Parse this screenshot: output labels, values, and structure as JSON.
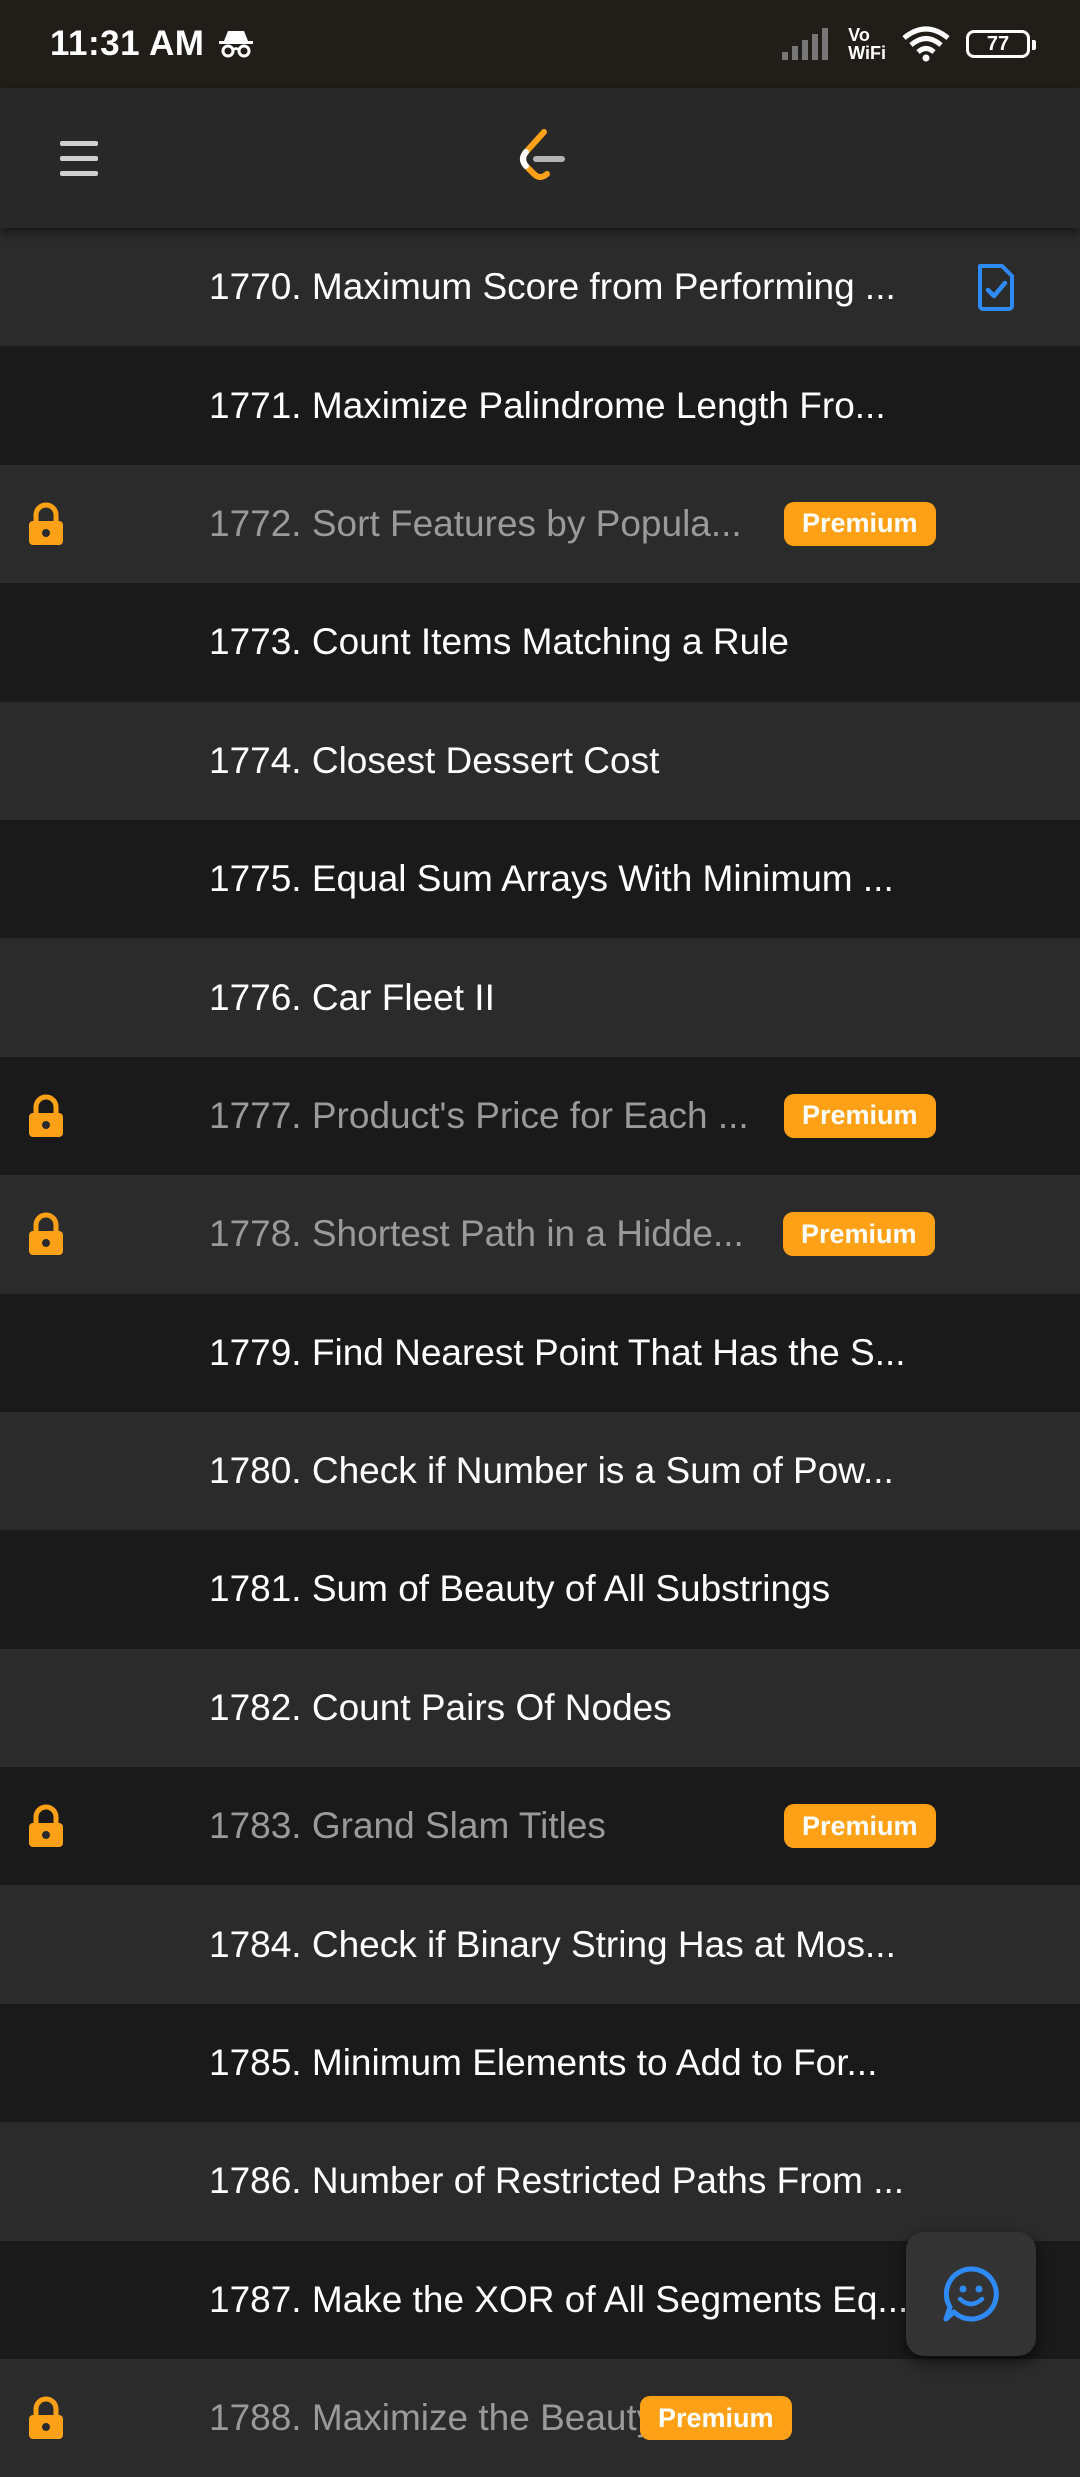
{
  "status_bar": {
    "time": "11:31 AM",
    "volte_top": "Vo",
    "volte_bottom": "WiFi",
    "battery": "77"
  },
  "header": {
    "menu_icon": "hamburger-menu-icon",
    "logo_icon": "leetcode-logo-icon"
  },
  "colors": {
    "premium": "#ffa116",
    "solved_icon": "#2f8af5",
    "row_light": "#2b2b2b",
    "row_dark": "#1a1a1a"
  },
  "problems": [
    {
      "title": "1770. Maximum Score from Performing ...",
      "locked": false,
      "premium": false,
      "solved": true
    },
    {
      "title": "1771. Maximize Palindrome Length Fro...",
      "locked": false,
      "premium": false,
      "solved": false
    },
    {
      "title": "1772. Sort Features by Popula...",
      "locked": true,
      "premium": true,
      "solved": false,
      "badge": "Premium"
    },
    {
      "title": "1773. Count Items Matching a Rule",
      "locked": false,
      "premium": false,
      "solved": false
    },
    {
      "title": "1774. Closest Dessert Cost",
      "locked": false,
      "premium": false,
      "solved": false
    },
    {
      "title": "1775. Equal Sum Arrays With Minimum ...",
      "locked": false,
      "premium": false,
      "solved": false
    },
    {
      "title": "1776. Car Fleet II",
      "locked": false,
      "premium": false,
      "solved": false
    },
    {
      "title": "1777. Product's Price for Each ...",
      "locked": true,
      "premium": true,
      "solved": false,
      "badge": "Premium"
    },
    {
      "title": "1778. Shortest Path in a Hidde...",
      "locked": true,
      "premium": true,
      "solved": false,
      "badge": "Premium"
    },
    {
      "title": "1779. Find Nearest Point That Has the S...",
      "locked": false,
      "premium": false,
      "solved": false
    },
    {
      "title": "1780. Check if Number is a Sum of Pow...",
      "locked": false,
      "premium": false,
      "solved": false
    },
    {
      "title": "1781. Sum of Beauty of All Substrings",
      "locked": false,
      "premium": false,
      "solved": false
    },
    {
      "title": "1782. Count Pairs Of Nodes",
      "locked": false,
      "premium": false,
      "solved": false
    },
    {
      "title": "1783. Grand Slam Titles",
      "locked": true,
      "premium": true,
      "solved": false,
      "badge": "Premium"
    },
    {
      "title": "1784. Check if Binary String Has at Mos...",
      "locked": false,
      "premium": false,
      "solved": false
    },
    {
      "title": "1785. Minimum Elements to Add to For...",
      "locked": false,
      "premium": false,
      "solved": false
    },
    {
      "title": "1786. Number of Restricted Paths From ...",
      "locked": false,
      "premium": false,
      "solved": false
    },
    {
      "title": "1787. Make the XOR of All Segments Eq...",
      "locked": false,
      "premium": false,
      "solved": false
    },
    {
      "title": "1788. Maximize the Beauty of ...",
      "locked": true,
      "premium": true,
      "solved": false,
      "badge": "Premium"
    }
  ],
  "fab": {
    "icon": "feedback-smile-icon"
  }
}
